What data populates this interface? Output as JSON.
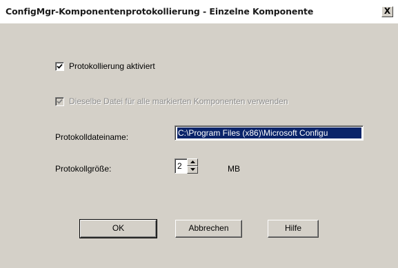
{
  "window": {
    "title": "ConfigMgr-Komponentenprotokollierung - Einzelne Komponente",
    "close_glyph": "X"
  },
  "logging_enabled": {
    "label": "Protokollierung aktiviert",
    "checked": true
  },
  "same_file": {
    "label": "Dieselbe Datei für alle markierten Komponenten verwenden",
    "checked": true,
    "disabled": true
  },
  "log_file": {
    "label": "Protokolldateiname:",
    "value": "C:\\Program Files (x86)\\Microsoft Configu"
  },
  "log_size": {
    "label": "Protokollgröße:",
    "value": "2",
    "unit": "MB"
  },
  "buttons": {
    "ok": "OK",
    "cancel": "Abbrechen",
    "help": "Hilfe"
  },
  "colors": {
    "dialog_bg": "#d4d0c8",
    "selection_bg": "#0a246a",
    "disabled_text": "#8c8c8c"
  },
  "icons": [
    "checkmark-icon",
    "spin-up-arrow-icon",
    "spin-down-arrow-icon",
    "close-icon"
  ]
}
